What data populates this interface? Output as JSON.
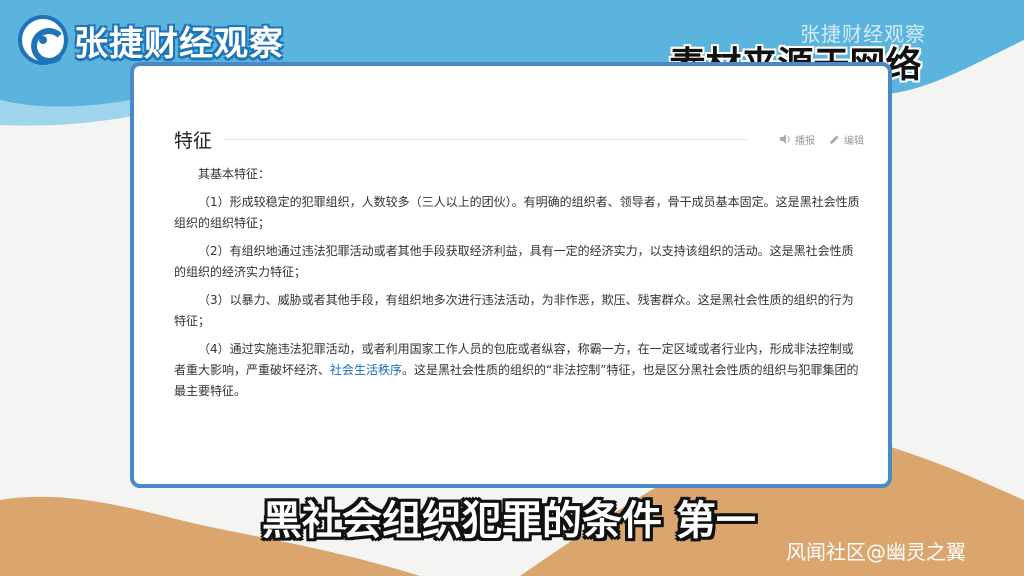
{
  "header": {
    "logo_text": "张捷财经观察",
    "watermark_top": "张捷财经观察",
    "source_note": "--- 素材来源于网络"
  },
  "section": {
    "title": "特征",
    "report_label": "播报",
    "edit_label": "编辑"
  },
  "content": {
    "intro": "其基本特征：",
    "features": [
      {
        "text": "（1）形成较稳定的犯罪组织，人数较多（三人以上的团伙）。有明确的组织者、领导者，骨干成员基本固定。这是黑社会性质组织的组织特征；"
      },
      {
        "text": "（2）有组织地通过违法犯罪活动或者其他手段获取经济利益，具有一定的经济实力，以支持该组织的活动。这是黑社会性质的组织的经济实力特征；"
      },
      {
        "text": "（3）以暴力、威胁或者其他手段，有组织地多次进行违法活动，为非作恶，欺压、残害群众。这是黑社会性质的组织的行为特征；"
      },
      {
        "before": "（4）通过实施违法犯罪活动，或者利用国家工作人员的包庇或者纵容，称霸一方，在一定区域或者行业内，形成非法控制或者重大影响，严重破坏经济、",
        "link": "社会生活秩序",
        "after": "。这是黑社会性质的组织的“非法控制”特征，也是区分黑社会性质的组织与犯罪集团的最主要特征。"
      }
    ]
  },
  "subtitle": "黑社会组织犯罪的条件 第一",
  "watermark_bottom": "风闻社区@幽灵之翼",
  "colors": {
    "sky": "#5ab4dd",
    "sand": "#dba56e",
    "card_border": "#4a88c6",
    "link": "#136ec2"
  }
}
